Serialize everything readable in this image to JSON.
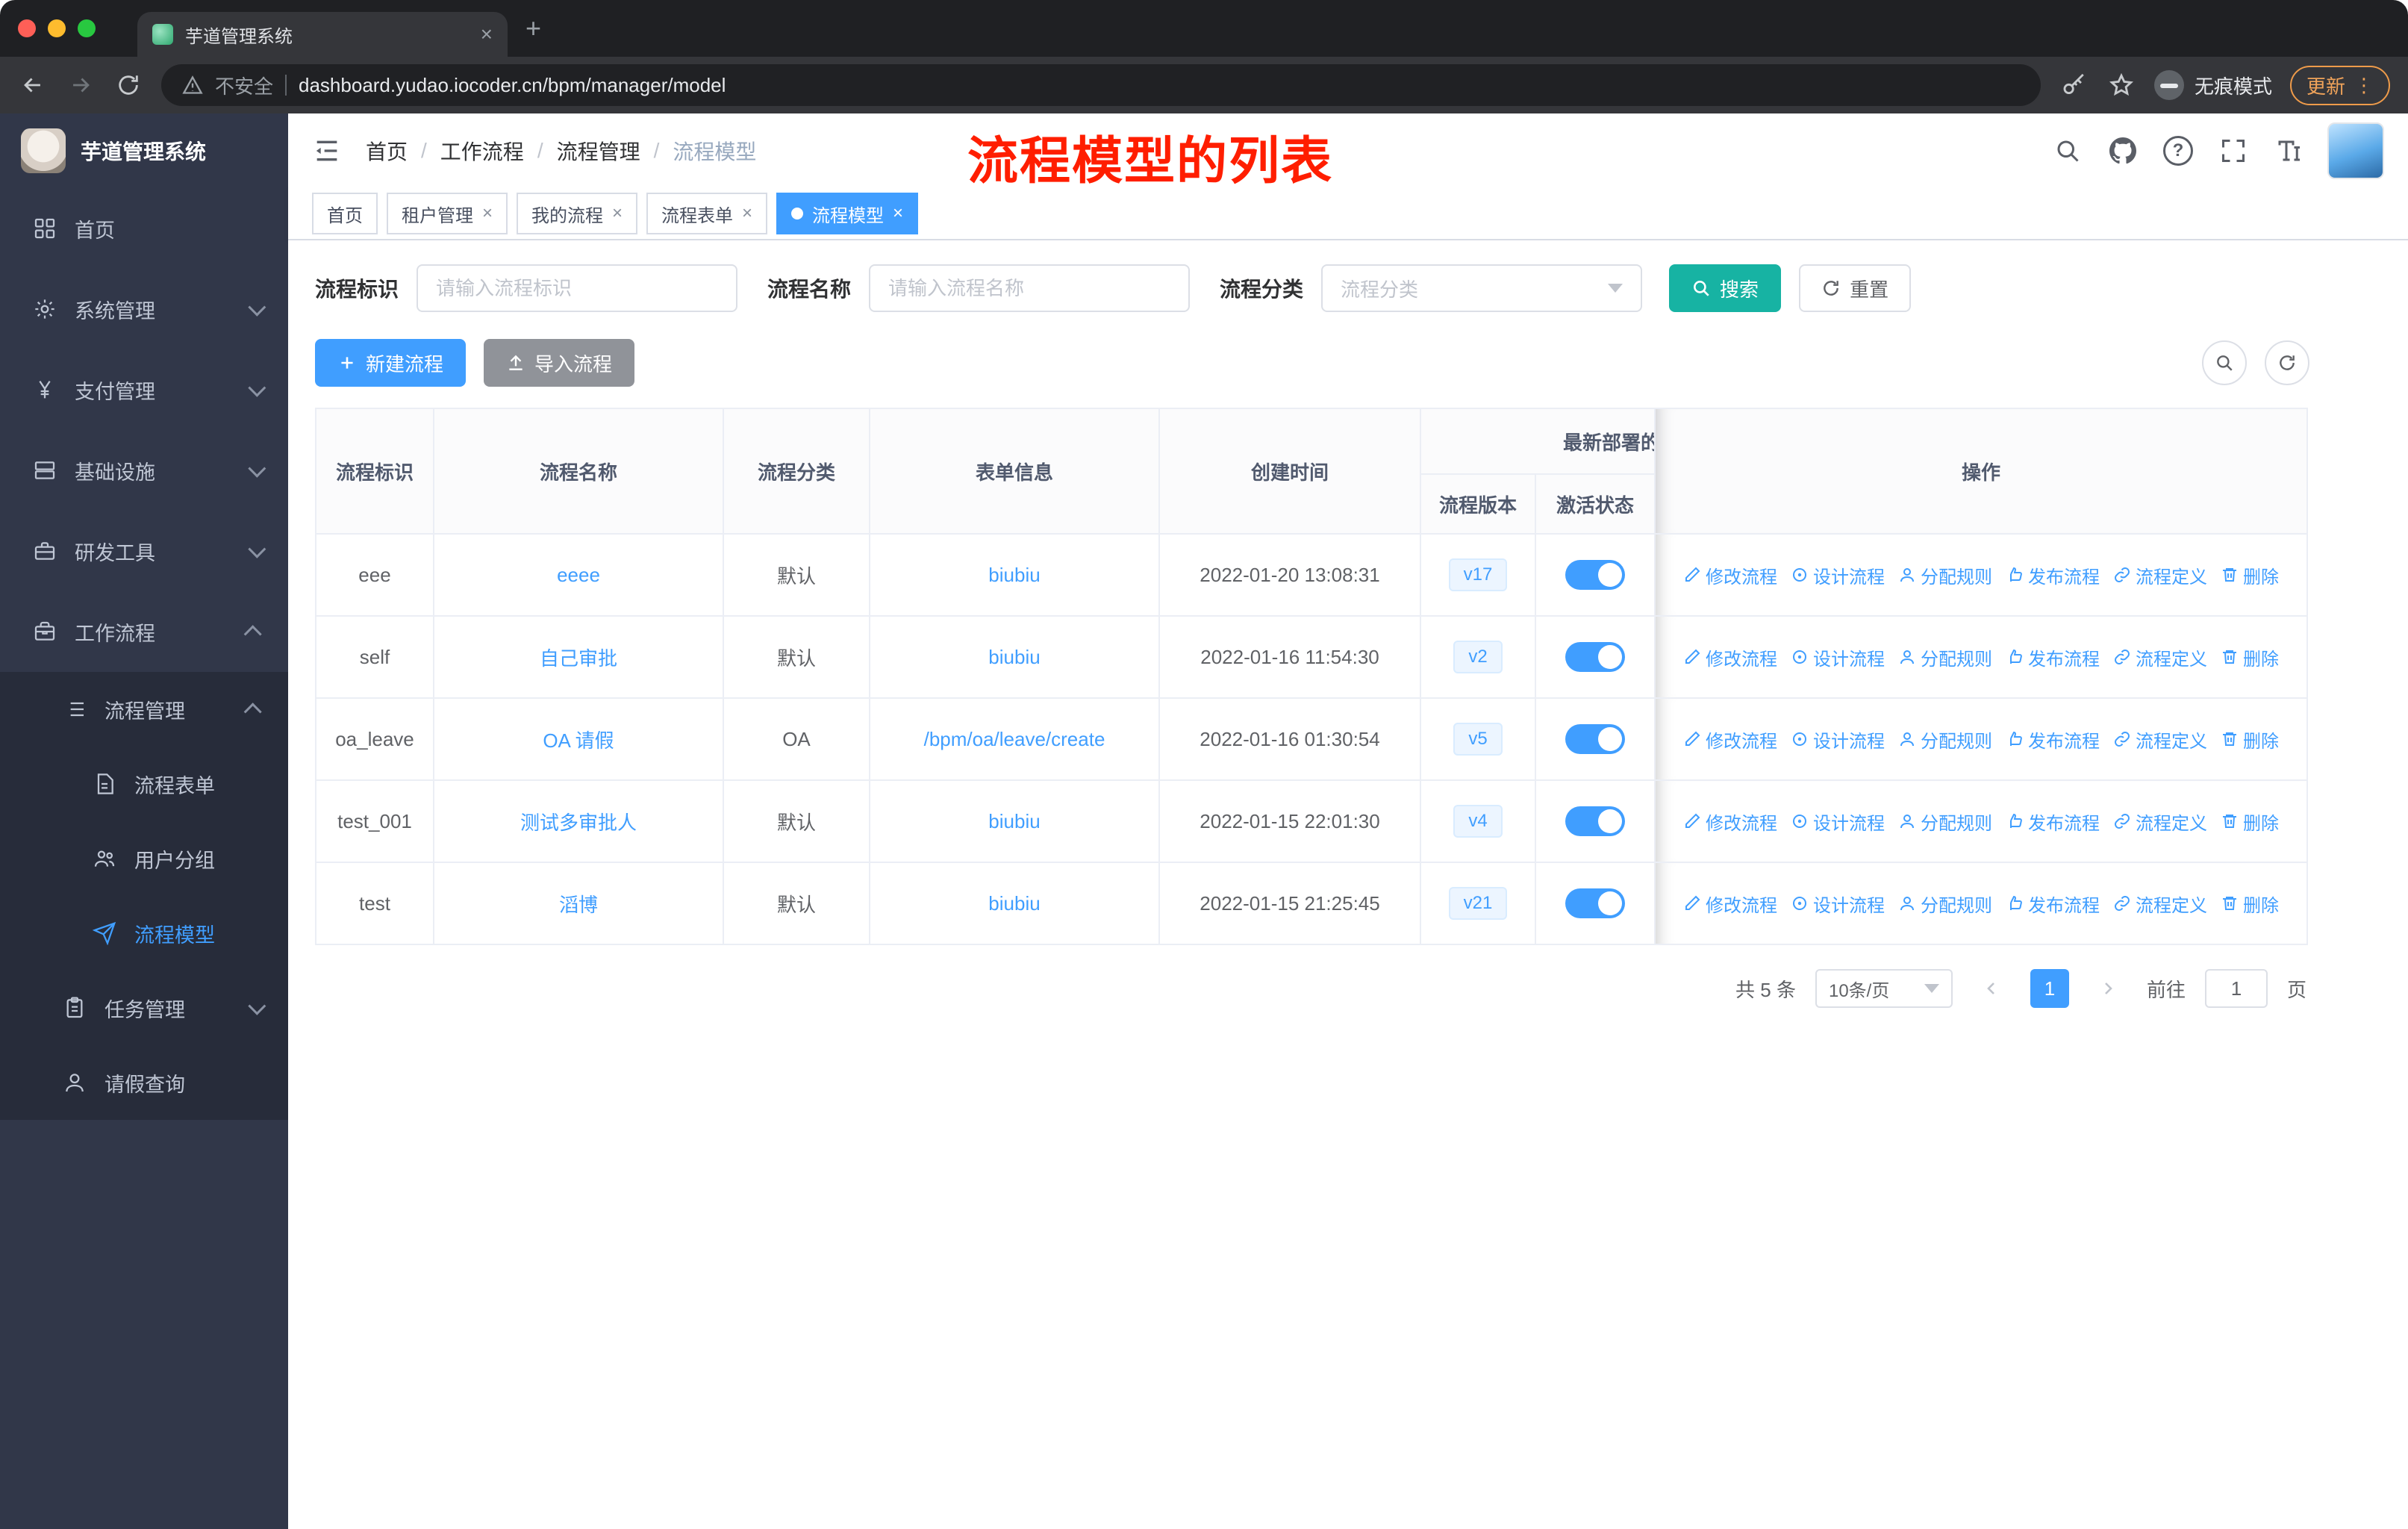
{
  "colors": {
    "primary": "#409eff",
    "search_button": "#17b3a3",
    "sidebar_bg": "#313749",
    "submenu_bg": "#272c3a",
    "annotation_red": "#ff1e00",
    "active_tag": "#409eff"
  },
  "icons": {
    "close": "×",
    "plus": "+",
    "ellipsis": "⋮",
    "help": "?"
  },
  "browser": {
    "tab_title": "芋道管理系统",
    "security_label": "不安全",
    "url": "dashboard.yudao.iocoder.cn/bpm/manager/model",
    "incognito_label": "无痕模式",
    "update_label": "更新"
  },
  "sidebar": {
    "brand": "芋道管理系统",
    "items": [
      {
        "label": "首页"
      },
      {
        "label": "系统管理"
      },
      {
        "label": "支付管理"
      },
      {
        "label": "基础设施"
      },
      {
        "label": "研发工具"
      },
      {
        "label": "工作流程"
      },
      {
        "label": "流程管理"
      },
      {
        "label": "流程表单"
      },
      {
        "label": "用户分组"
      },
      {
        "label": "流程模型"
      },
      {
        "label": "任务管理"
      },
      {
        "label": "请假查询"
      }
    ]
  },
  "topbar": {
    "breadcrumb": [
      "首页",
      "工作流程",
      "流程管理",
      "流程模型"
    ],
    "annotation": "流程模型的列表"
  },
  "tags": [
    {
      "label": "首页"
    },
    {
      "label": "租户管理"
    },
    {
      "label": "我的流程"
    },
    {
      "label": "流程表单"
    },
    {
      "label": "流程模型"
    }
  ],
  "filters": {
    "id_label": "流程标识",
    "id_placeholder": "请输入流程标识",
    "name_label": "流程名称",
    "name_placeholder": "请输入流程名称",
    "category_label": "流程分类",
    "category_placeholder": "流程分类",
    "search_label": "搜索",
    "reset_label": "重置"
  },
  "toolbar": {
    "create_label": "新建流程",
    "import_label": "导入流程"
  },
  "table": {
    "headers": {
      "id": "流程标识",
      "name": "流程名称",
      "category": "流程分类",
      "form": "表单信息",
      "created": "创建时间",
      "deploy_group": "最新部署的",
      "version": "流程版本",
      "active": "激活状态",
      "actions": "操作"
    },
    "rows": [
      {
        "id": "eee",
        "name": "eeee",
        "category": "默认",
        "form": "biubiu",
        "created": "2022-01-20 13:08:31",
        "version": "v17",
        "active": true
      },
      {
        "id": "self",
        "name": "自己审批",
        "category": "默认",
        "form": "biubiu",
        "created": "2022-01-16 11:54:30",
        "version": "v2",
        "active": true
      },
      {
        "id": "oa_leave",
        "name": "OA 请假",
        "category": "OA",
        "form": "/bpm/oa/leave/create",
        "created": "2022-01-16 01:30:54",
        "version": "v5",
        "active": true
      },
      {
        "id": "test_001",
        "name": "测试多审批人",
        "category": "默认",
        "form": "biubiu",
        "created": "2022-01-15 22:01:30",
        "version": "v4",
        "active": true
      },
      {
        "id": "test",
        "name": "滔博",
        "category": "默认",
        "form": "biubiu",
        "created": "2022-01-15 21:25:45",
        "version": "v21",
        "active": true
      }
    ],
    "actions": [
      "修改流程",
      "设计流程",
      "分配规则",
      "发布流程",
      "流程定义",
      "删除"
    ]
  },
  "pagination": {
    "total": "共 5 条",
    "page_size": "10条/页",
    "page": "1",
    "goto_label": "前往",
    "goto_value": "1",
    "goto_unit": "页"
  }
}
